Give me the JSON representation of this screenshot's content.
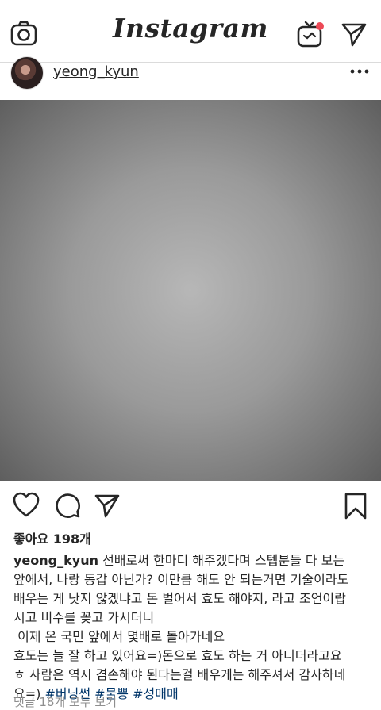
{
  "app": {
    "brand": "Instagram"
  },
  "topbar": {
    "left_icon": "camera-icon",
    "right_icons": [
      "igtv-icon",
      "direct-send-icon"
    ],
    "notification_color": "#ed4956"
  },
  "post": {
    "username": "yeong_kyun",
    "more_icon": "more-dots-icon",
    "actions": [
      "heart-icon",
      "comment-icon",
      "share-icon",
      "bookmark-icon"
    ],
    "likes": "좋아요 198개",
    "caption": {
      "username": "yeong_kyun",
      "line1_text": "선배로써 한마디 해주겠다며 스텝분들 다 보는",
      "line2": "앞에서, 나랑 동갑 아닌가? 이만큼 해도 안 되는거면 기술이라도",
      "line3": "배우는 게 낫지 않겠냐고 돈 벌어서 효도 해야지, 라고 조언이랍",
      "line4": "시고 비수를 꽂고 가시더니",
      "line5": " 이제 온 국민 앞에서 몇배로 돌아가네요",
      "line6": "효도는 늘 잘 하고 있어요=)돈으로 효도 하는 거 아니더라고요",
      "line7": "ㅎ 사람은 역시 겸손해야 된다는걸 배우게는 해주셔서 감사하네",
      "line8_text": "요=)",
      "hashtags": [
        "#버닝썬",
        "#물뽕",
        "#성매매"
      ]
    },
    "comments_link": "댓글 18개 모두 보기"
  }
}
